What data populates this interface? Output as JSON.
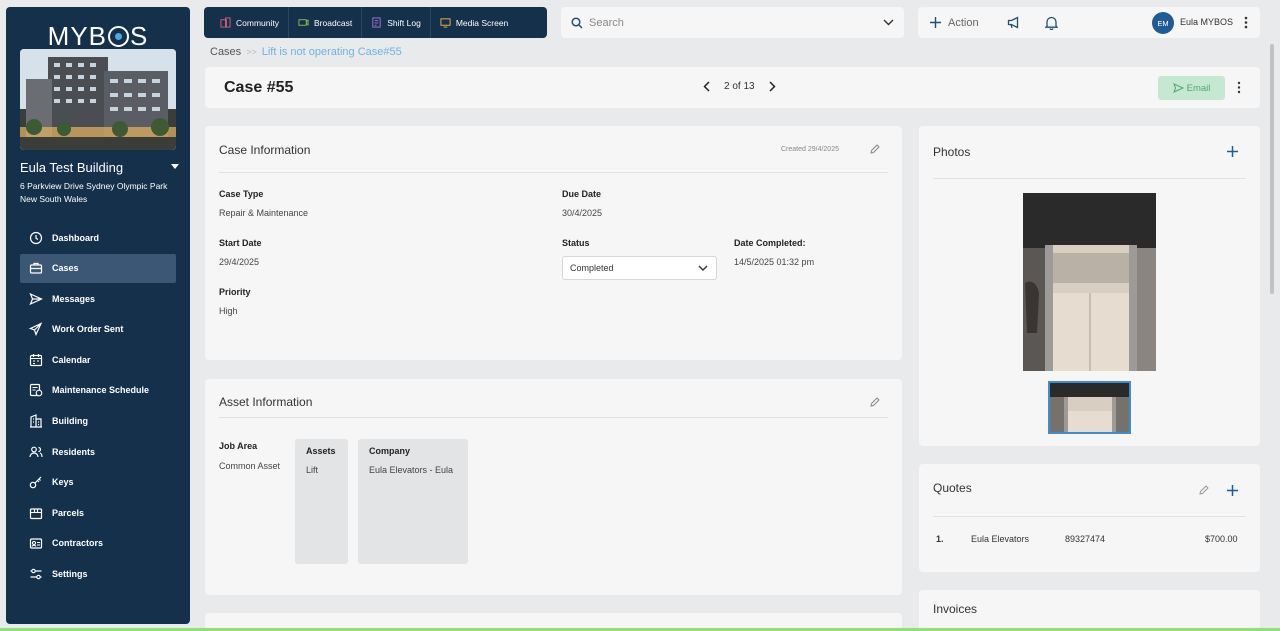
{
  "sidebar": {
    "logo": "MYBOS",
    "building_name": "Eula Test Building",
    "building_address": "6 Parkview Drive Sydney Olympic Park New South Wales",
    "items": [
      {
        "label": "Dashboard",
        "icon": "clock-icon"
      },
      {
        "label": "Cases",
        "icon": "briefcase-icon"
      },
      {
        "label": "Messages",
        "icon": "send-icon"
      },
      {
        "label": "Work Order Sent",
        "icon": "megaphone-icon"
      },
      {
        "label": "Calendar",
        "icon": "calendar-icon"
      },
      {
        "label": "Maintenance Schedule",
        "icon": "schedule-icon"
      },
      {
        "label": "Building",
        "icon": "building-icon"
      },
      {
        "label": "Residents",
        "icon": "people-icon"
      },
      {
        "label": "Keys",
        "icon": "key-icon"
      },
      {
        "label": "Parcels",
        "icon": "parcel-icon"
      },
      {
        "label": "Contractors",
        "icon": "contractor-icon"
      },
      {
        "label": "Settings",
        "icon": "settings-icon"
      }
    ],
    "active_index": 1
  },
  "topbar": {
    "buttons": [
      {
        "label": "Community",
        "icon": "community-icon"
      },
      {
        "label": "Broadcast",
        "icon": "broadcast-icon"
      },
      {
        "label": "Shift Log",
        "icon": "shift-log-icon"
      },
      {
        "label": "Media Screen",
        "icon": "media-screen-icon"
      }
    ],
    "search_placeholder": "Search",
    "action_label": "Action",
    "user_initials": "EM",
    "user_name": "Eula MYBOS"
  },
  "breadcrumb": {
    "root": "Cases",
    "current": "Lift is not operating Case#55"
  },
  "header": {
    "title": "Case #55",
    "pager": "2 of 13",
    "email_label": "Email"
  },
  "case_info": {
    "title": "Case Information",
    "created": "Created 29/4/2025",
    "case_type_label": "Case Type",
    "case_type": "Repair & Maintenance",
    "due_date_label": "Due Date",
    "due_date": "30/4/2025",
    "start_date_label": "Start Date",
    "start_date": "29/4/2025",
    "status_label": "Status",
    "status": "Completed",
    "date_completed_label": "Date Completed:",
    "date_completed": "14/5/2025 01:32 pm",
    "priority_label": "Priority",
    "priority": "High"
  },
  "asset_info": {
    "title": "Asset Information",
    "job_area_label": "Job Area",
    "job_area": "Common Asset",
    "assets_label": "Assets",
    "assets": "Lift",
    "company_label": "Company",
    "company": "Eula Elevators - Eula"
  },
  "photos": {
    "title": "Photos"
  },
  "quotes": {
    "title": "Quotes",
    "rows": [
      {
        "index": "1.",
        "company": "Eula Elevators",
        "number": "89327474",
        "amount": "$700.00"
      }
    ]
  },
  "invoices": {
    "title": "Invoices"
  },
  "colors": {
    "sidebar": "#14304b",
    "accent": "#49a9e6",
    "email": "#c6e8d3"
  }
}
